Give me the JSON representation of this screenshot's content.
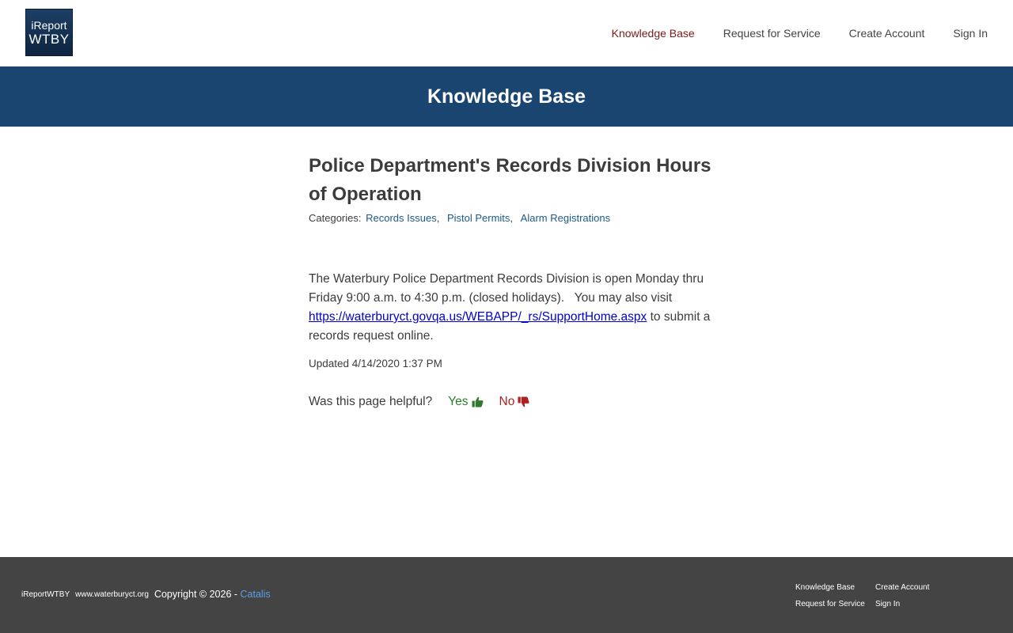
{
  "header": {
    "logo_line1": "iReport",
    "logo_line2": "WTBY",
    "nav": [
      "Knowledge Base",
      "Request for Service",
      "Create Account",
      "Sign In"
    ]
  },
  "banner": {
    "title": "Knowledge Base"
  },
  "article": {
    "title": "Police Department's Records Division Hours of Operation",
    "categories_label": "Categories:",
    "categories": [
      "Records Issues",
      "Pistol Permits",
      "Alarm Registrations"
    ],
    "body_before": "The Waterbury Police Department Records Division is open Monday thru Friday 9:00 a.m. to 4:30 p.m. (closed holidays).   You may also visit ",
    "body_link": "https://waterburyct.govqa.us/WEBAPP/_rs/SupportHome.aspx",
    "body_after": " to submit a records request online.",
    "updated": "Updated 4/14/2020 1:37 PM"
  },
  "feedback": {
    "question": "Was this page helpful?",
    "yes": "Yes",
    "no": "No"
  },
  "footer": {
    "brand": "iReportWTBY",
    "site": "www.waterburyct.org",
    "copyright": "Copyright © 2026 -",
    "vendor": "Catalis",
    "links": [
      "Knowledge Base",
      "Create Account",
      "Request for Service",
      "Sign In"
    ]
  },
  "colors": {
    "banner": "#1a4570",
    "active_nav": "#7a1a1a",
    "yes": "#2c7a2c",
    "no": "#b02020",
    "footer": "#444444"
  },
  "icons": [
    "thumbs-up-icon",
    "thumbs-down-icon"
  ]
}
